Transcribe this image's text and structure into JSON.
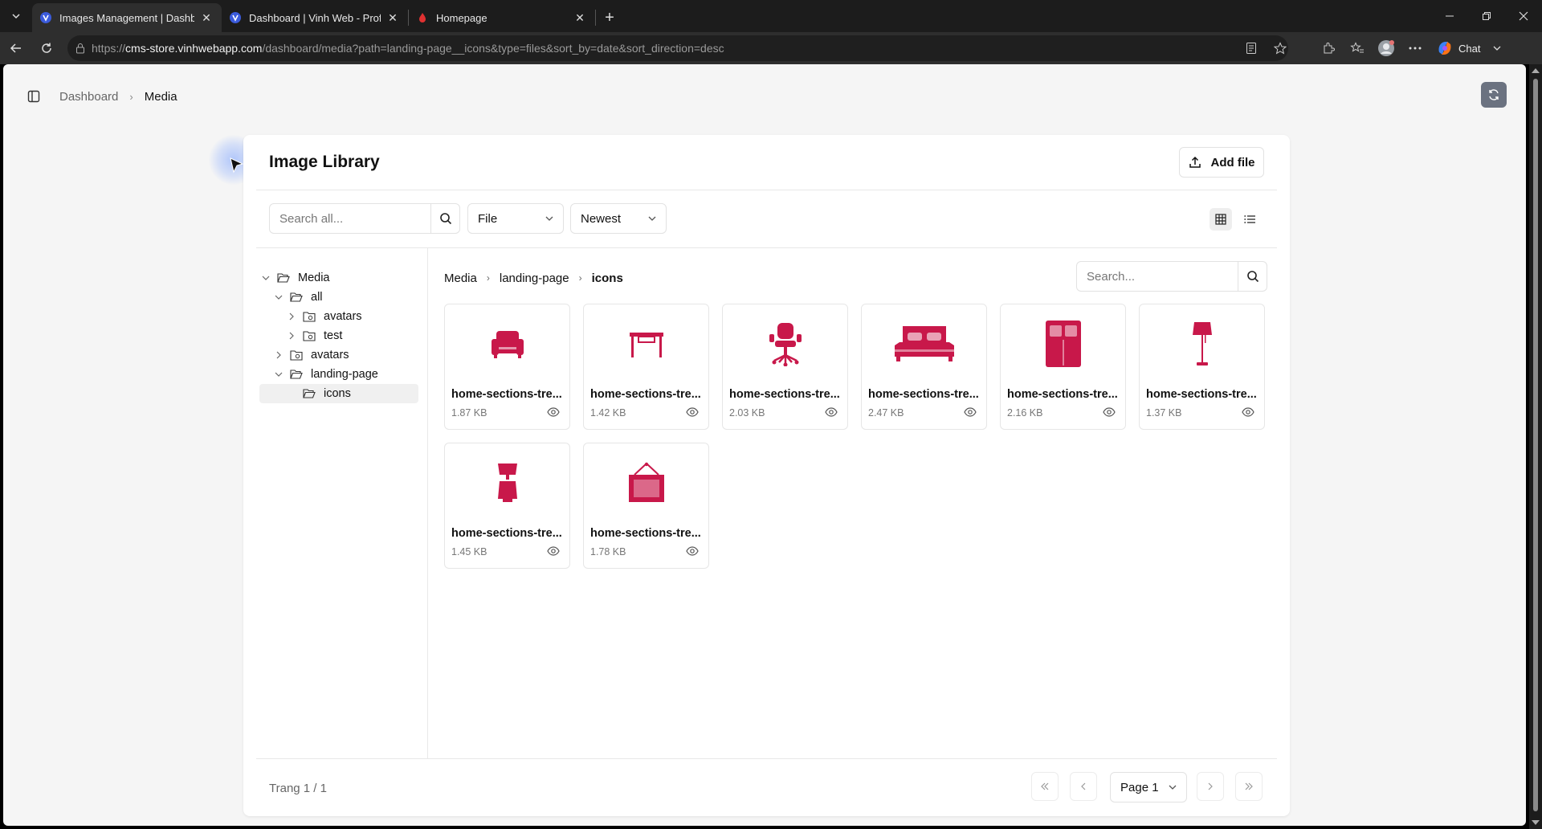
{
  "browser": {
    "tabs": [
      {
        "label": "Images Management | Dashboard",
        "active": true,
        "favicon": "vinh-logo-icon"
      },
      {
        "label": "Dashboard | Vinh Web - Professio",
        "active": false,
        "favicon": "vinh-logo-icon"
      },
      {
        "label": "Homepage",
        "active": false,
        "favicon": "red-flame-icon"
      }
    ],
    "url_prefix": "https://",
    "url_host": "cms-store.vinhwebapp.com",
    "url_path": "/dashboard/media?path=landing-page__icons&type=files&sort_by=date&sort_direction=desc",
    "chat_label": "Chat"
  },
  "topbar": {
    "breadcrumb": [
      "Dashboard",
      "Media"
    ]
  },
  "library": {
    "title": "Image Library",
    "add_file_label": "Add file",
    "search_placeholder": "Search all...",
    "type_select": "File",
    "sort_select": "Newest",
    "content_search_placeholder": "Search..."
  },
  "tree": {
    "nodes": [
      {
        "label": "Media",
        "depth": 0,
        "expanded": true,
        "selected": false
      },
      {
        "label": "all",
        "depth": 1,
        "expanded": true,
        "selected": false
      },
      {
        "label": "avatars",
        "depth": 2,
        "expanded": false,
        "selected": false
      },
      {
        "label": "test",
        "depth": 2,
        "expanded": false,
        "selected": false
      },
      {
        "label": "avatars",
        "depth": 1,
        "expanded": false,
        "selected": false
      },
      {
        "label": "landing-page",
        "depth": 1,
        "expanded": true,
        "selected": false
      },
      {
        "label": "icons",
        "depth": 2,
        "expanded": null,
        "selected": true
      }
    ]
  },
  "path": [
    "Media",
    "landing-page",
    "icons"
  ],
  "files": [
    {
      "name": "home-sections-tre...",
      "size": "1.87 KB",
      "icon": "armchair-icon"
    },
    {
      "name": "home-sections-tre...",
      "size": "1.42 KB",
      "icon": "desk-icon"
    },
    {
      "name": "home-sections-tre...",
      "size": "2.03 KB",
      "icon": "office-chair-icon"
    },
    {
      "name": "home-sections-tre...",
      "size": "2.47 KB",
      "icon": "bed-icon"
    },
    {
      "name": "home-sections-tre...",
      "size": "2.16 KB",
      "icon": "wardrobe-icon"
    },
    {
      "name": "home-sections-tre...",
      "size": "1.37 KB",
      "icon": "floor-lamp-icon"
    },
    {
      "name": "home-sections-tre...",
      "size": "1.45 KB",
      "icon": "table-lamp-icon"
    },
    {
      "name": "home-sections-tre...",
      "size": "1.78 KB",
      "icon": "wall-frame-icon"
    }
  ],
  "pagination": {
    "info": "Trang 1 / 1",
    "page_select": "Page 1"
  },
  "colors": {
    "accent_icon": "#c8184a",
    "refresh_button": "#6b7280"
  }
}
